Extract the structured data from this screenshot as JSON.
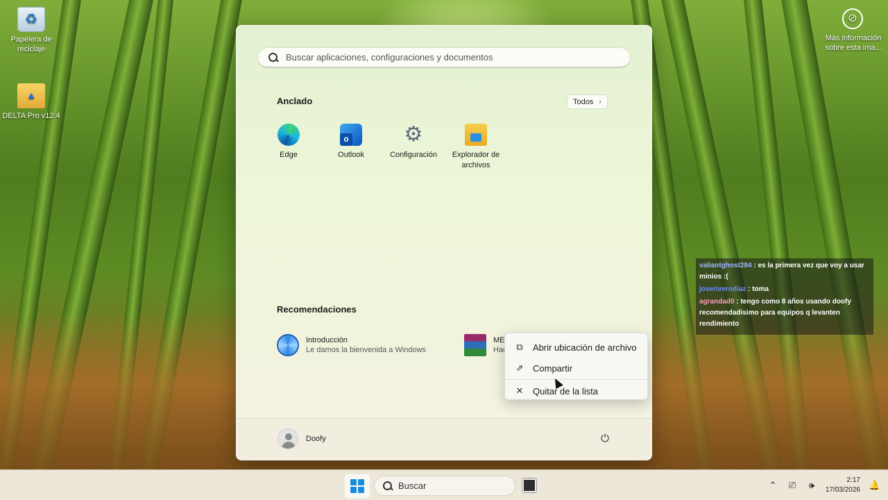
{
  "desktop": {
    "icons": [
      {
        "label": "Papelera de reciclaje"
      },
      {
        "label": "DELTA Pro v12.4"
      }
    ],
    "info_label": "Más información sobre esta ima..."
  },
  "start_menu": {
    "search_placeholder": "Buscar aplicaciones, configuraciones y documentos",
    "pinned_title": "Anclado",
    "all_button": "Todos",
    "pinned": [
      {
        "label": "Edge",
        "icon": "edge-icon"
      },
      {
        "label": "Outlook",
        "icon": "outlook-icon"
      },
      {
        "label": "Configuración",
        "icon": "settings-gear-icon"
      },
      {
        "label": "Explorador de archivos",
        "icon": "folder-icon"
      }
    ],
    "recommended_title": "Recomendaciones",
    "recommended": [
      {
        "title": "Introducción",
        "subtitle": "Le damos la bienvenida a Windows",
        "icon": "intro-icon"
      },
      {
        "title": "ME",
        "subtitle": "Hac",
        "icon": "winrar-icon"
      }
    ],
    "user_name": "Doofy"
  },
  "context_menu": {
    "items": [
      {
        "label": "Abrir ubicación de archivo",
        "icon": "open-location-icon"
      },
      {
        "label": "Compartir",
        "icon": "share-icon"
      },
      {
        "label": "Quitar de la lista",
        "icon": "close-icon"
      }
    ]
  },
  "chat": [
    {
      "user": "valiantghost284",
      "text": ": es la primera vez que voy a usar minios :("
    },
    {
      "user": "joseriverodiaz",
      "text": ": toma"
    },
    {
      "user": "agrandad0",
      "text": ": tengo como 8 años usando doofy recomendadisimo para equipos q levanten rendimiento"
    }
  ],
  "taskbar": {
    "search_label": "Buscar",
    "time": "2:17",
    "date": "17/03/2026"
  }
}
